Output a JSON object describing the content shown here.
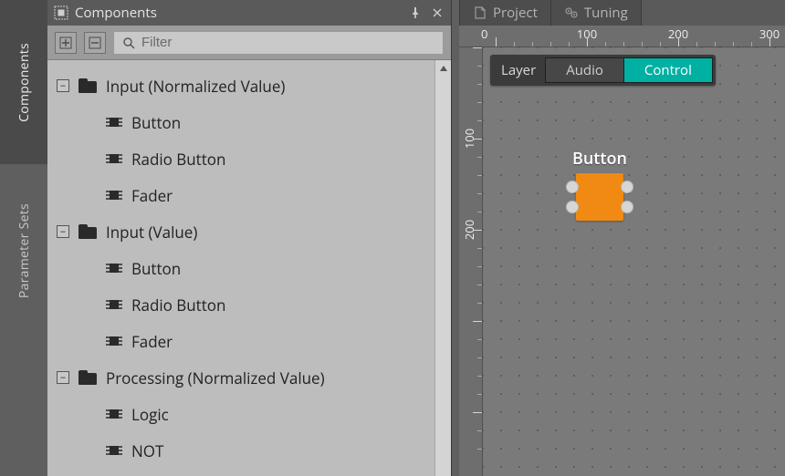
{
  "vtabs": {
    "components": "Components",
    "parameter_sets": "Parameter Sets"
  },
  "panel": {
    "title": "Components",
    "filter_placeholder": "Filter"
  },
  "tree": {
    "groups": [
      {
        "label": "Input (Normalized Value)",
        "items": [
          "Button",
          "Radio Button",
          "Fader"
        ]
      },
      {
        "label": "Input (Value)",
        "items": [
          "Button",
          "Radio Button",
          "Fader"
        ]
      },
      {
        "label": "Processing (Normalized Value)",
        "items": [
          "Logic",
          "NOT"
        ]
      }
    ]
  },
  "tabs": {
    "project": "Project",
    "tuning": "Tuning"
  },
  "ruler": {
    "h_labels": [
      "0",
      "100",
      "200",
      "300"
    ],
    "v_labels": [
      "100",
      "200"
    ]
  },
  "layer": {
    "label": "Layer",
    "audio": "Audio",
    "control": "Control",
    "active": "control"
  },
  "node": {
    "title": "Button"
  },
  "colors": {
    "accent": "#00b1a3",
    "node": "#f08a12"
  }
}
